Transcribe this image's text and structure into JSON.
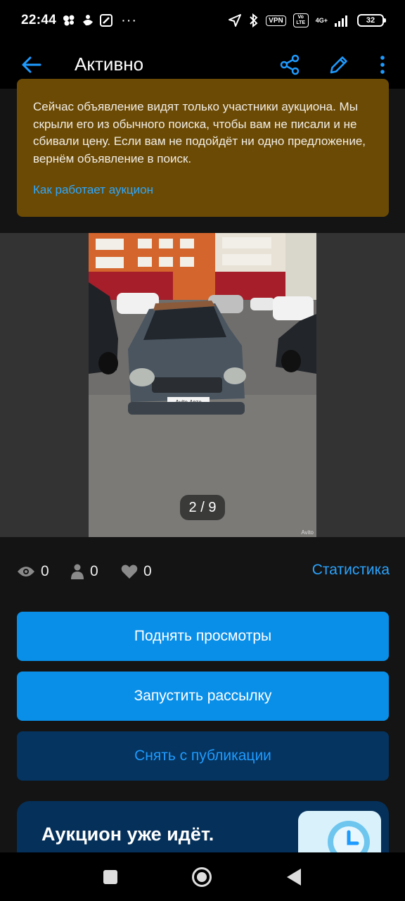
{
  "status_bar": {
    "time": "22:44",
    "overflow": "···",
    "vpn_label": "VPN",
    "volte_label": "Vo LTE",
    "network_label": "4G+",
    "battery": "32"
  },
  "app_bar": {
    "title": "Активно"
  },
  "auction_notice": {
    "text": "Сейчас объявление видят только участники аукциона. Мы скрыли его из обычного поиска, чтобы вам не писали и не сбивали цену. Если вам не подойдёт ни одно предложение, вернём объявление в поиск.",
    "link": "Как работает аукцион",
    "color": "#6b4a05"
  },
  "gallery": {
    "counter": "2 / 9",
    "watermark": "Avito",
    "plate_text": "Avito Авто"
  },
  "stats": {
    "views": "0",
    "contacts": "0",
    "favorites": "0",
    "link": "Статистика"
  },
  "actions": {
    "raise_views": "Поднять просмотры",
    "start_mailing": "Запустить рассылку",
    "unpublish": "Снять с публикации"
  },
  "promo": {
    "title": "Аукцион уже идёт."
  },
  "colors": {
    "accent": "#0a8fe8",
    "link": "#2ea8ff",
    "background": "#141414"
  }
}
